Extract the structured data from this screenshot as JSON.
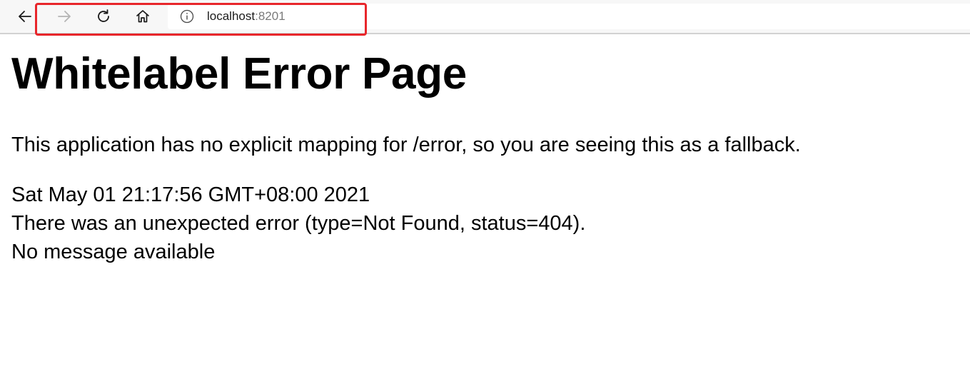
{
  "browser": {
    "address": {
      "host": "localhost",
      "port": ":8201"
    },
    "colors": {
      "highlight": "#e8262b",
      "toolbar_bg": "#f7f7f7"
    },
    "icons": [
      "back-arrow-icon",
      "forward-arrow-icon",
      "refresh-icon",
      "home-icon",
      "info-icon"
    ]
  },
  "page": {
    "title": "Whitelabel Error Page",
    "intro": "This application has no explicit mapping for /error, so you are seeing this as a fallback.",
    "timestamp": "Sat May 01 21:17:56 GMT+08:00 2021",
    "error_line": "There was an unexpected error (type=Not Found, status=404).",
    "message": "No message available"
  }
}
